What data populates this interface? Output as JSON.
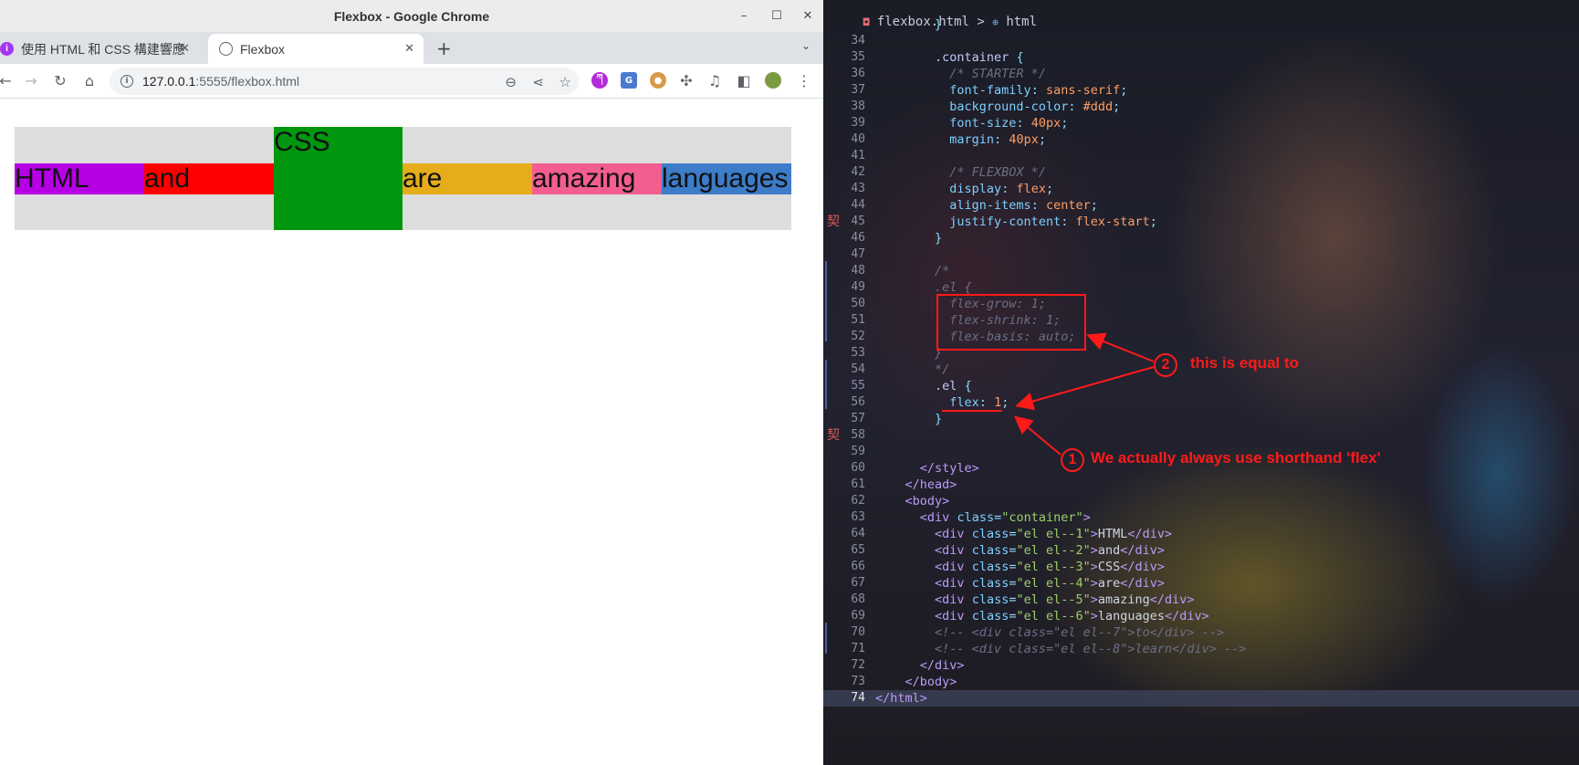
{
  "window": {
    "title": "Flexbox - Google Chrome",
    "minimize_glyph": "–",
    "maximize_glyph": "☐",
    "close_glyph": "✕"
  },
  "tabs": [
    {
      "label": "使用 HTML 和 CSS 構建響應",
      "favicon": "udemy-icon",
      "active": false
    },
    {
      "label": "Flexbox",
      "favicon": "globe-icon",
      "active": true
    }
  ],
  "tab_close_glyph": "✕",
  "new_tab_glyph": "+",
  "tab_menu_glyph": "⌄",
  "address_bar": {
    "host": "127.0.0.1",
    "path": ":5555/flexbox.html"
  },
  "page": {
    "items": [
      "HTML",
      "and",
      "CSS",
      "are",
      "amazing",
      "languages"
    ],
    "colors": [
      "#b600e4",
      "#ff0000",
      "#00960e",
      "#e5ad1a",
      "#f35e8f",
      "#3d7cc9"
    ],
    "container_bg": "#dddddd"
  },
  "editor": {
    "breadcrumb": {
      "file": "flexbox.html",
      "separator": ">",
      "node": "html"
    },
    "lines": [
      {
        "n": "",
        "html": "        <span class='pun'>}</span>"
      },
      {
        "n": "34",
        "html": ""
      },
      {
        "n": "35",
        "html": "        <span class='sel'>.container</span> <span class='pun'>{</span>"
      },
      {
        "n": "36",
        "html": "          <span class='cm'>/* STARTER */</span>"
      },
      {
        "n": "37",
        "html": "          <span class='prop'>font-family</span><span class='pun'>:</span> <span class='val'>sans-serif</span><span class='pun'>;</span>"
      },
      {
        "n": "38",
        "html": "          <span class='prop'>background-color</span><span class='pun'>:</span> <span class='val'>#ddd</span><span class='pun'>;</span>"
      },
      {
        "n": "39",
        "html": "          <span class='prop'>font-size</span><span class='pun'>:</span> <span class='val'>40px</span><span class='pun'>;</span>"
      },
      {
        "n": "40",
        "html": "          <span class='prop'>margin</span><span class='pun'>:</span> <span class='val'>40px</span><span class='pun'>;</span>"
      },
      {
        "n": "41",
        "html": ""
      },
      {
        "n": "42",
        "html": "          <span class='cm'>/* FLEXBOX */</span>"
      },
      {
        "n": "43",
        "html": "          <span class='prop'>display</span><span class='pun'>:</span> <span class='val'>flex</span><span class='pun'>;</span>"
      },
      {
        "n": "44",
        "html": "          <span class='prop'>align-items</span><span class='pun'>:</span> <span class='val'>center</span><span class='pun'>;</span>"
      },
      {
        "n": "45",
        "html": "          <span class='prop'>justify-content</span><span class='pun'>:</span> <span class='val'>flex-start</span><span class='pun'>;</span>"
      },
      {
        "n": "46",
        "html": "        <span class='pun'>}</span>"
      },
      {
        "n": "47",
        "html": ""
      },
      {
        "n": "48",
        "html": "        <span class='cm'>/*</span>"
      },
      {
        "n": "49",
        "html": "        <span class='cm'>.el {</span>"
      },
      {
        "n": "50",
        "html": "          <span class='cm'>flex-grow: 1;</span>"
      },
      {
        "n": "51",
        "html": "          <span class='cm'>flex-shrink: 1;</span>"
      },
      {
        "n": "52",
        "html": "          <span class='cm'>flex-basis: auto;</span>"
      },
      {
        "n": "53",
        "html": "        <span class='cm'>}</span>"
      },
      {
        "n": "54",
        "html": "        <span class='cm'>*/</span>"
      },
      {
        "n": "55",
        "html": "        <span class='sel'>.el</span> <span class='pun'>{</span>"
      },
      {
        "n": "56",
        "html": "          <span class='prop'>flex</span><span class='pun'>:</span> <span class='val'>1</span><span class='pun'>;</span>"
      },
      {
        "n": "57",
        "html": "        <span class='pun'>}</span>"
      },
      {
        "n": "58",
        "html": ""
      },
      {
        "n": "59",
        "html": ""
      },
      {
        "n": "60",
        "html": "      <span class='tag'>&lt;/style&gt;</span>"
      },
      {
        "n": "61",
        "html": "    <span class='tag'>&lt;/head&gt;</span>"
      },
      {
        "n": "62",
        "html": "    <span class='tag'>&lt;body&gt;</span>"
      },
      {
        "n": "63",
        "html": "      <span class='tag'>&lt;div</span> <span class='prop'>class</span><span class='pun'>=</span><span class='str'>\"container\"</span><span class='tag'>&gt;</span>"
      },
      {
        "n": "64",
        "html": "        <span class='tag'>&lt;div</span> <span class='prop'>class</span><span class='pun'>=</span><span class='str'>\"el el--1\"</span><span class='tag'>&gt;</span><span class='txt'>HTML</span><span class='tag'>&lt;/div&gt;</span>"
      },
      {
        "n": "65",
        "html": "        <span class='tag'>&lt;div</span> <span class='prop'>class</span><span class='pun'>=</span><span class='str'>\"el el--2\"</span><span class='tag'>&gt;</span><span class='txt'>and</span><span class='tag'>&lt;/div&gt;</span>"
      },
      {
        "n": "66",
        "html": "        <span class='tag'>&lt;div</span> <span class='prop'>class</span><span class='pun'>=</span><span class='str'>\"el el--3\"</span><span class='tag'>&gt;</span><span class='txt'>CSS</span><span class='tag'>&lt;/div&gt;</span>"
      },
      {
        "n": "67",
        "html": "        <span class='tag'>&lt;div</span> <span class='prop'>class</span><span class='pun'>=</span><span class='str'>\"el el--4\"</span><span class='tag'>&gt;</span><span class='txt'>are</span><span class='tag'>&lt;/div&gt;</span>"
      },
      {
        "n": "68",
        "html": "        <span class='tag'>&lt;div</span> <span class='prop'>class</span><span class='pun'>=</span><span class='str'>\"el el--5\"</span><span class='tag'>&gt;</span><span class='txt'>amazing</span><span class='tag'>&lt;/div&gt;</span>"
      },
      {
        "n": "69",
        "html": "        <span class='tag'>&lt;div</span> <span class='prop'>class</span><span class='pun'>=</span><span class='str'>\"el el--6\"</span><span class='tag'>&gt;</span><span class='txt'>languages</span><span class='tag'>&lt;/div&gt;</span>"
      },
      {
        "n": "70",
        "html": "        <span class='cm'>&lt;!-- &lt;div class=\"el el--7\"&gt;to&lt;/div&gt; --&gt;</span>"
      },
      {
        "n": "71",
        "html": "        <span class='cm'>&lt;!-- &lt;div class=\"el el--8\"&gt;learn&lt;/div&gt; --&gt;</span>"
      },
      {
        "n": "72",
        "html": "      <span class='tag'>&lt;/div&gt;</span>"
      },
      {
        "n": "73",
        "html": "    <span class='tag'>&lt;/body&gt;</span>"
      },
      {
        "n": "74",
        "html": "<span class='tag'>&lt;/html&gt;</span>"
      }
    ],
    "gutter_glyph": "契"
  },
  "annotations": {
    "one_number": "1",
    "one_text": "We actually always use shorthand 'flex'",
    "two_number": "2",
    "two_text": "this is equal to"
  }
}
